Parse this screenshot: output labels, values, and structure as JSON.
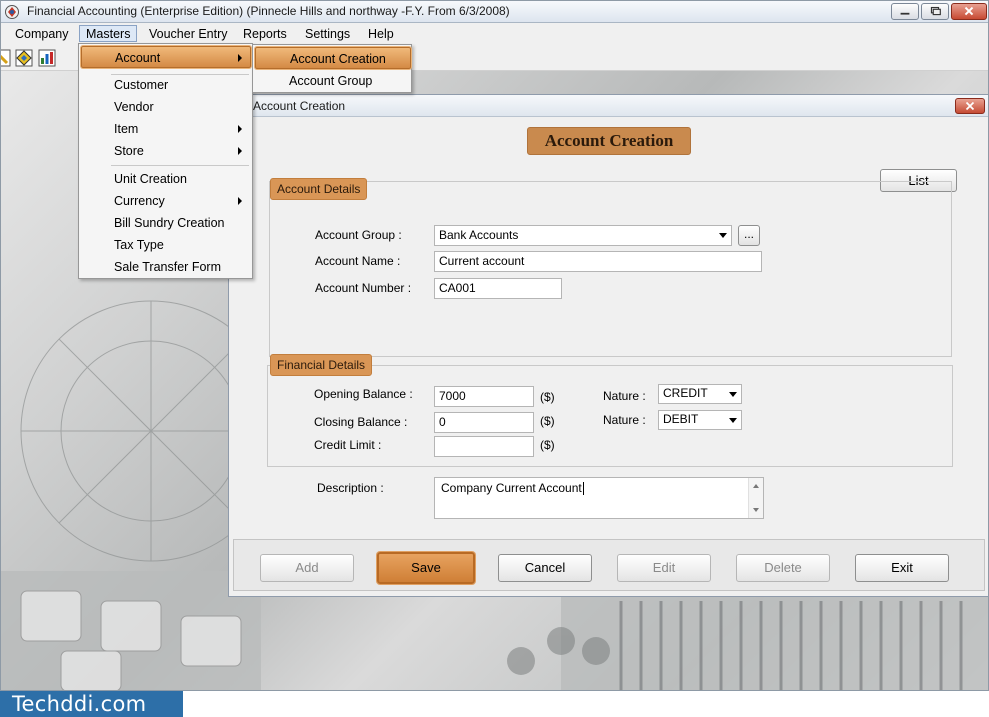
{
  "app": {
    "title": "Financial Accounting (Enterprise Edition) (Pinnecle Hills and northway -F.Y. From 6/3/2008)",
    "window_controls": [
      "minimize",
      "maximize",
      "close"
    ]
  },
  "menubar": {
    "items": [
      "Company",
      "Masters",
      "Voucher Entry",
      "Reports",
      "Settings",
      "Help"
    ],
    "active": "Masters"
  },
  "toolbar": {
    "icons": [
      "partial-icon",
      "diamond-icon",
      "chart-icon"
    ]
  },
  "masters_menu": {
    "items": [
      {
        "label": "Account",
        "has_submenu": true,
        "highlighted": true
      },
      {
        "label": "Customer"
      },
      {
        "label": "Vendor"
      },
      {
        "label": "Item",
        "has_submenu": true
      },
      {
        "label": "Store",
        "has_submenu": true
      },
      {
        "label": "Unit Creation"
      },
      {
        "label": "Currency",
        "has_submenu": true
      },
      {
        "label": "Bill Sundry Creation"
      },
      {
        "label": "Tax Type"
      },
      {
        "label": "Sale Transfer Form"
      }
    ]
  },
  "account_submenu": {
    "items": [
      {
        "label": "Account Creation",
        "highlighted": true
      },
      {
        "label": "Account Group"
      }
    ]
  },
  "child_window": {
    "title": "Account Creation",
    "heading": "Account Creation",
    "list_button": "List",
    "account_details": {
      "label": "Account Details",
      "group_label": "Account Group :",
      "group_value": "Bank Accounts",
      "browse_label": "...",
      "name_label": "Account Name :",
      "name_value": "Current account",
      "number_label": "Account Number :",
      "number_value": "CA001"
    },
    "financial_details": {
      "label": "Financial Details",
      "opening_label": "Opening Balance :",
      "opening_value": "7000",
      "closing_label": "Closing Balance :",
      "closing_value": "0",
      "credit_label": "Credit Limit :",
      "credit_value": "",
      "currency_unit": "($)",
      "nature_label": "Nature :",
      "opening_nature": "CREDIT",
      "closing_nature": "DEBIT"
    },
    "description_label": "Description :",
    "description_value": "Company Current Account",
    "buttons": {
      "add": "Add",
      "save": "Save",
      "cancel": "Cancel",
      "edit": "Edit",
      "delete": "Delete",
      "exit": "Exit"
    }
  },
  "brand": "Techddi.com"
}
